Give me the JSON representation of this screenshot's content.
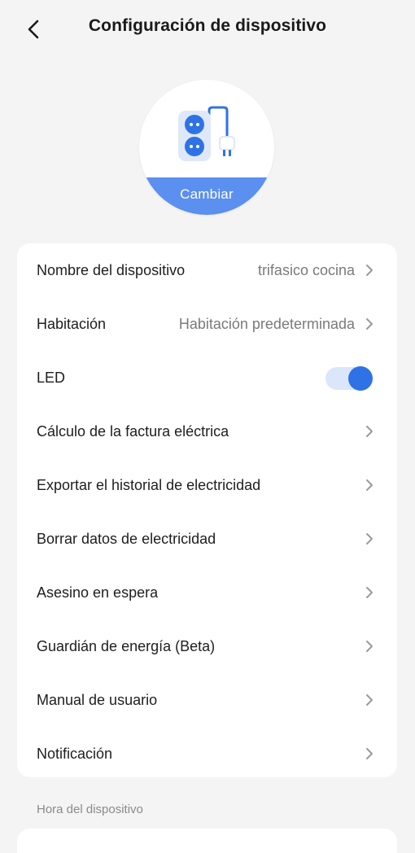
{
  "header": {
    "title": "Configuración de dispositivo",
    "back_icon": "chevron-left-icon"
  },
  "avatar": {
    "icon": "power-strip-icon",
    "change_label": "Cambiar"
  },
  "settings": [
    {
      "label": "Nombre del dispositivo",
      "value": "trifasico cocina",
      "type": "nav"
    },
    {
      "label": "Habitación",
      "value": "Habitación predeterminada",
      "type": "nav"
    },
    {
      "label": "LED",
      "type": "toggle",
      "enabled": true
    },
    {
      "label": "Cálculo de la factura eléctrica",
      "type": "nav"
    },
    {
      "label": "Exportar el historial de electricidad",
      "type": "nav"
    },
    {
      "label": "Borrar datos de electricidad",
      "type": "nav"
    },
    {
      "label": "Asesino en espera",
      "type": "nav"
    },
    {
      "label": "Guardián de energía (Beta)",
      "type": "nav"
    },
    {
      "label": "Manual de usuario",
      "type": "nav"
    },
    {
      "label": "Notificación",
      "type": "nav"
    }
  ],
  "section": {
    "device_time_label": "Hora del dispositivo"
  },
  "colors": {
    "accent": "#2f72e6",
    "toggle_track": "#dbe6fb",
    "change_band": "#5b8ff0",
    "background": "#f4f4f4"
  }
}
